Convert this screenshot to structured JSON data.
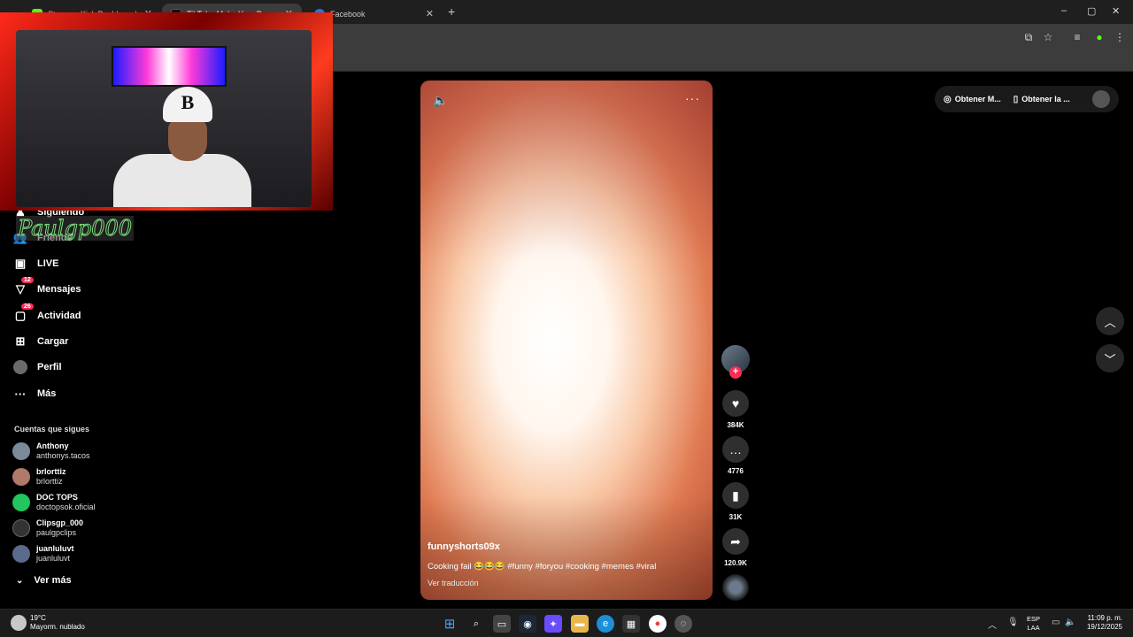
{
  "browser": {
    "tabs": [
      {
        "label": "Stream - Kick Dashboard",
        "color": "#53fc18"
      },
      {
        "label": "TikTok - Make Your Day",
        "color": "#111111"
      },
      {
        "label": "Facebook",
        "color": "#1877f2"
      }
    ],
    "new_tab": "+",
    "window_controls": [
      "–",
      "▢",
      "✕"
    ]
  },
  "overlay": {
    "streamer_name": "Paulgp000",
    "cap_letter": "B"
  },
  "sidebar": {
    "items": [
      {
        "label": "Siguiendo",
        "icon": "following-icon"
      },
      {
        "label": "Friends",
        "icon": "friends-icon"
      },
      {
        "label": "LIVE",
        "icon": "live-icon"
      },
      {
        "label": "Mensajes",
        "icon": "messages-icon",
        "badge": "12"
      },
      {
        "label": "Actividad",
        "icon": "activity-icon",
        "badge": "26"
      },
      {
        "label": "Cargar",
        "icon": "upload-icon"
      },
      {
        "label": "Perfil",
        "icon": "profile-icon"
      },
      {
        "label": "Más",
        "icon": "more-icon"
      }
    ],
    "following_header": "Cuentas que sigues",
    "accounts": [
      {
        "name": "Anthony",
        "handle": "anthonys.tacos",
        "color": "#7a8a9a"
      },
      {
        "name": "brlorttiz",
        "handle": "brlorttiz",
        "color": "#b07a6a"
      },
      {
        "name": "DOC TOPS",
        "handle": "doctopsok.oficial",
        "color": "#22c55e"
      },
      {
        "name": "Clipsgp_000",
        "handle": "paulgpclips",
        "color": "#333333"
      },
      {
        "name": "juanluluvt",
        "handle": "juanluluvt",
        "color": "#5a6a8a"
      }
    ],
    "see_more": "Ver más"
  },
  "video": {
    "author": "funnyshorts09x",
    "caption": "Cooking fail 😂😂😂 #funny #foryou #cooking #memes #viral",
    "translate": "Ver traducción"
  },
  "actions": {
    "likes": "384K",
    "comments": "4776",
    "saves": "31K",
    "shares": "120.9K"
  },
  "top_actions": {
    "get_coins": "Obtener M...",
    "get_app": "Obtener la ..."
  },
  "taskbar": {
    "temperature": "19°C",
    "weather": "Mayorm. nublado",
    "lang_line1": "ESP",
    "lang_line2": "LAA",
    "time": "11:09 p. m.",
    "date": "19/12/2025"
  },
  "colors": {
    "accent": "#fe2c55",
    "background": "#000000"
  }
}
